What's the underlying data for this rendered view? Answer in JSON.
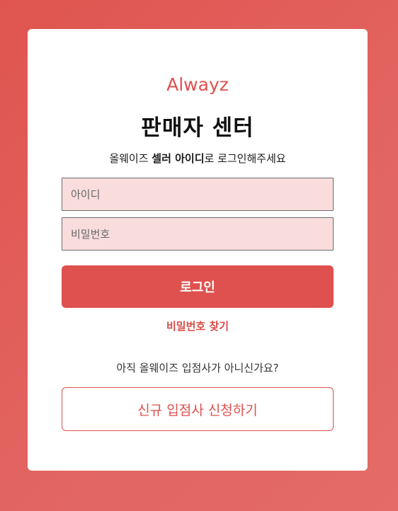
{
  "brand": {
    "logo_text": "Alwayz",
    "color": "#e04f4f"
  },
  "header": {
    "title": "판매자 센터",
    "subtitle_prefix": "올웨이즈 ",
    "subtitle_bold": "셀러 아이디",
    "subtitle_suffix": "로 로그인해주세요"
  },
  "form": {
    "id_placeholder": "아이디",
    "id_value": "",
    "password_placeholder": "비밀번호",
    "password_value": "",
    "login_label": "로그인",
    "find_password_label": "비밀번호 찾기"
  },
  "signup": {
    "prompt": "아직 올웨이즈 입점사가 아니신가요?",
    "apply_label": "신규 입점사 신청하기"
  },
  "colors": {
    "accent": "#de514e",
    "background": "#e0554f",
    "input_bg": "#f9dddd"
  }
}
